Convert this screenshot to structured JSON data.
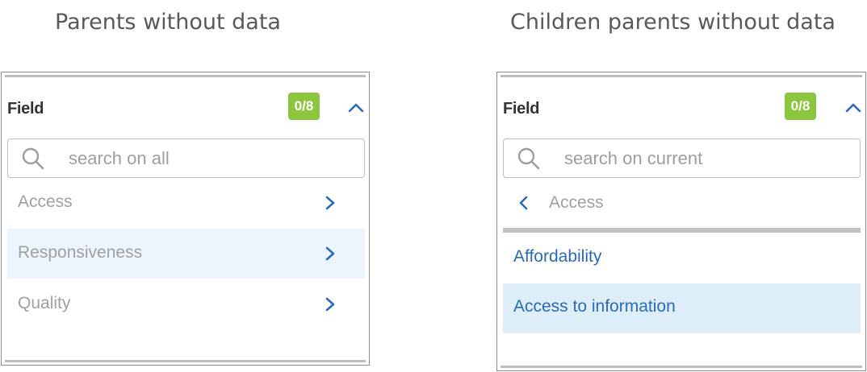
{
  "captions": {
    "left": "Parents without data",
    "right": "Children parents without data"
  },
  "panels": [
    {
      "field_label": "Field",
      "count": "0/8",
      "search": {
        "placeholder": "search on all",
        "value": ""
      },
      "items": [
        {
          "label": "Access",
          "highlighted": false
        },
        {
          "label": "Responsiveness",
          "highlighted": true
        },
        {
          "label": "Quality",
          "highlighted": false
        }
      ]
    },
    {
      "field_label": "Field",
      "count": "0/8",
      "search": {
        "placeholder": "search on current",
        "value": ""
      },
      "back": {
        "label": "Access"
      },
      "children": [
        {
          "label": "Affordability",
          "highlighted": false
        },
        {
          "label": "Access to information",
          "highlighted": true
        }
      ]
    }
  ],
  "colors": {
    "accent": "#2a6bb8",
    "badge": "#8cc63f",
    "highlight_left": "#edf5fc",
    "highlight_right": "#deeef9",
    "muted_text": "#a0a0a0"
  },
  "icons": {
    "collapse": "chevron-up-icon",
    "search": "search-icon",
    "expand": "chevron-right-icon",
    "back": "chevron-left-icon"
  }
}
